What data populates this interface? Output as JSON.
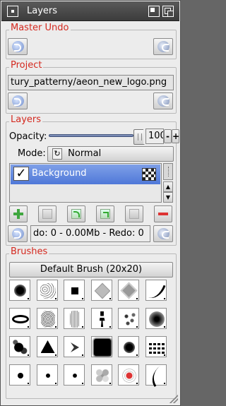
{
  "window": {
    "title": "Layers"
  },
  "master_undo": {
    "label": "Master Undo"
  },
  "project": {
    "label": "Project",
    "filename": "tury_patterny/aeon_new_logo.png"
  },
  "layers": {
    "label": "Layers",
    "opacity_label": "Opacity:",
    "opacity_value": "100",
    "opacity_fraction": 1.0,
    "minus_label": "-",
    "plus_label": "+",
    "mode_label": "Mode:",
    "mode_value": "Normal",
    "items": [
      {
        "name": "Background",
        "visible": true,
        "selected": true
      }
    ],
    "undo_status": "do: 0 - 0.00Mb - Redo: 0"
  },
  "brushes": {
    "label": "Brushes",
    "selected_name": "Default Brush (20x20)",
    "items": [
      "round-soft-large",
      "speckle-noise",
      "square-small",
      "diamond-gray",
      "diamond-gray-2",
      "stroke-curve",
      "ellipse-ring",
      "noise-cluster",
      "noise-tall",
      "figure-small",
      "scatter-dots",
      "round-soft-large-2",
      "splatter",
      "triangle",
      "chevron",
      "square-rough",
      "round-soft-medium",
      "brick-pattern",
      "dot-small",
      "dot-small-2",
      "dot-small-3",
      "cloud-blob",
      "red-splat",
      "stroke-curve-2"
    ]
  },
  "colors": {
    "accent_label": "#d4291f",
    "selection": "#5a80d9"
  }
}
